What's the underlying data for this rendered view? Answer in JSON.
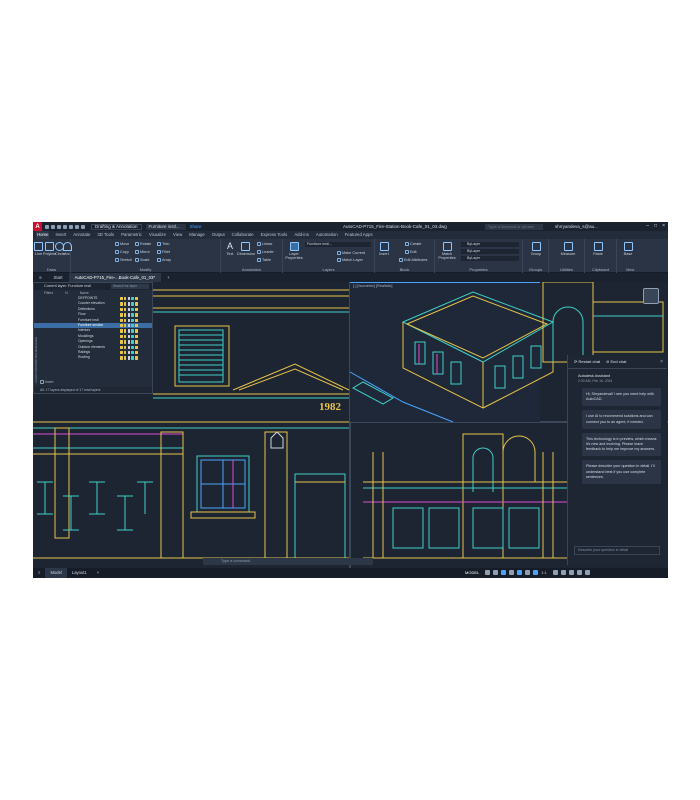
{
  "app": {
    "logo": "A",
    "workspace": "Drafting & Annotation",
    "layer_picker": "Furniture instl...",
    "share": "Share",
    "document_title": "AutoCAD-P715_Fire-Station-Book-Cafe_01_03.dwg",
    "search_placeholder": "Type a keyword or phrase",
    "user": "shrryandeva_s@au..."
  },
  "ribbon_tabs": [
    "Home",
    "Insert",
    "Annotate",
    "3D Tools",
    "Parametric",
    "Visualize",
    "View",
    "Manage",
    "Output",
    "Collaborate",
    "Express Tools",
    "Add-ins",
    "Automation",
    "Featured Apps"
  ],
  "active_tab": "Home",
  "ribbon": {
    "draw": {
      "label": "Draw",
      "buttons": [
        "Line",
        "Polyline",
        "Circle",
        "Arc"
      ]
    },
    "modify": {
      "label": "Modify",
      "buttons": [
        "Move",
        "Rotate",
        "Trim",
        "Copy",
        "Mirror",
        "Fillet",
        "Stretch",
        "Scale",
        "Array"
      ]
    },
    "annotation": {
      "label": "Annotation",
      "buttons": [
        "Text",
        "Dimension",
        "Linear",
        "Leader",
        "Table"
      ]
    },
    "layers": {
      "label": "Layers",
      "buttons": [
        "Layer Properties",
        "Make Current",
        "Match Layer"
      ],
      "current": "Furniture instl..."
    },
    "block": {
      "label": "Block",
      "buttons": [
        "Insert",
        "Create",
        "Edit",
        "Edit Attributes"
      ]
    },
    "properties": {
      "label": "Properties",
      "buttons": [
        "Match Properties"
      ],
      "values": [
        "ByLayer",
        "ByLayer",
        "ByLayer"
      ]
    },
    "groups": {
      "label": "Groups",
      "buttons": [
        "Group"
      ]
    },
    "utilities": {
      "label": "Utilities",
      "buttons": [
        "Measure"
      ]
    },
    "clipboard": {
      "label": "Clipboard",
      "buttons": [
        "Paste"
      ]
    },
    "view": {
      "label": "View",
      "buttons": [
        "Base"
      ]
    }
  },
  "file_tabs": [
    "Start",
    "AutoCAD-P715_Fire-...Book-Cafe_01_03*"
  ],
  "palette": {
    "title": "Current layer: Furniture instl",
    "search_placeholder": "Search for layer",
    "columns": [
      "Filters",
      "N",
      "Name"
    ],
    "layers": [
      "DEFPOINTS",
      "Counter elevation",
      "Deflections",
      "Floor",
      "Furniture instl",
      "Furniture section",
      "Interiors",
      "Mouldings",
      "Openings",
      "Outdoor elements",
      "Railings",
      "Roofing"
    ],
    "selected_layer": "Furniture section",
    "invert_filter": "Invert",
    "footer": "All: 17 layers displayed of 17 total layers",
    "side_label": "LAYER PROPERTIES MANAGER"
  },
  "drawing": {
    "year_label": "1982",
    "viewport_label": "[-] [Isometric] [Realistic]"
  },
  "command_line": {
    "placeholder": "Type a command"
  },
  "chat": {
    "restart": "Restart chat",
    "end": "End chat",
    "agent_name": "Autodesk Assistant",
    "timestamp": "2:30 AM, Feb 16, 2024",
    "messages": [
      "Hi, Shryandeval! I see you need help with AutoCAD.",
      "I use AI to recommend solutions and can connect you to an agent, if needed.",
      "This technology is in preview, which means it's new and evolving. Please leave feedback to help me improve my answers.",
      "Please describe your question in detail. I'll understand best if you use complete sentences."
    ],
    "input_placeholder": "Describe your question in detail"
  },
  "status": {
    "tabs": [
      "Model",
      "Layout1"
    ],
    "model": "MODEL",
    "scale": "1:1"
  },
  "colors": {
    "background": "#1d2432",
    "accent": "#4aa3ff",
    "line_cyan": "#3fd1c8",
    "line_yellow": "#e7c44a",
    "line_magenta": "#e04ad1"
  }
}
